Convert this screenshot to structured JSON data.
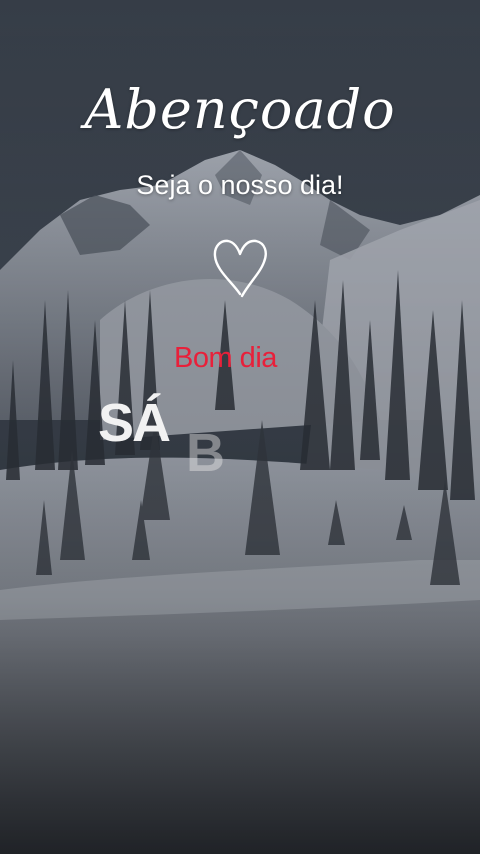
{
  "story": {
    "title": "Abençoado",
    "subtitle": "Seja o nosso dia!",
    "greeting": "Bom dia",
    "weekday_visible": "SÁ",
    "weekday_fading": "B"
  },
  "icons": {
    "heart": "heart-outline-icon"
  },
  "colors": {
    "greeting": "#e8203a",
    "text": "#ffffff",
    "sky": "#323944",
    "snow": "#d7dbe2",
    "trees": "#2c3138"
  }
}
